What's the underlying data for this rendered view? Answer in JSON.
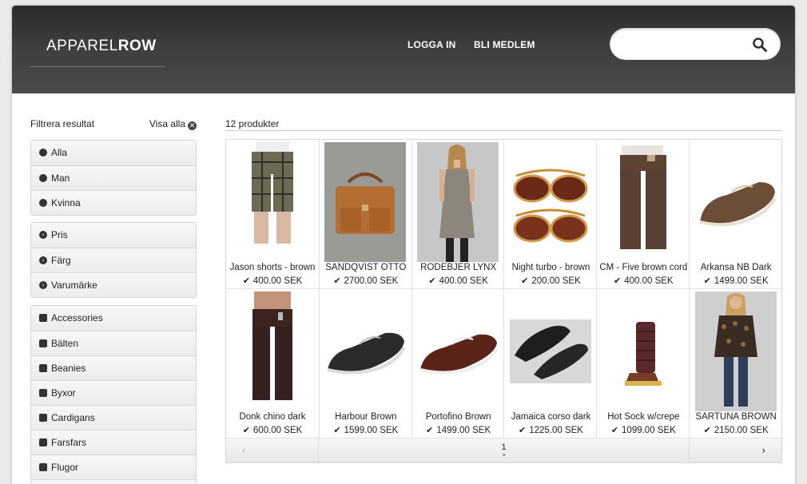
{
  "header": {
    "logo_light": "APPAREL",
    "logo_bold": "ROW",
    "nav": {
      "login": "LOGGA IN",
      "signup": "BLI MEDLEM"
    },
    "search": {
      "value": "",
      "placeholder": ""
    }
  },
  "sidebar": {
    "title": "Filtrera resultat",
    "show_all": "Visa alla",
    "gender": [
      "Alla",
      "Man",
      "Kvinna"
    ],
    "filters": [
      "Pris",
      "Färg",
      "Varumärke"
    ],
    "categories": [
      "Accessories",
      "Bälten",
      "Beanies",
      "Byxor",
      "Cardigans",
      "Farsfars",
      "Flugor"
    ]
  },
  "results": {
    "count": "12 produkter",
    "products": [
      {
        "name": "Jason shorts - brown",
        "price": "400.00 SEK",
        "img": "plaid-shorts"
      },
      {
        "name": "SANDQVIST OTTO",
        "price": "2700.00 SEK",
        "img": "leather-bag"
      },
      {
        "name": "RODEBJER LYNX",
        "price": "400.00 SEK",
        "img": "dress"
      },
      {
        "name": "Night turbo - brown",
        "price": "200.00 SEK",
        "img": "sunglasses"
      },
      {
        "name": "CM - Five brown cord",
        "price": "400.00 SEK",
        "img": "cord-pants"
      },
      {
        "name": "Arkansa NB Dark",
        "price": "1499.00 SEK",
        "img": "boat-shoe"
      },
      {
        "name": "Donk chino dark",
        "price": "600.00 SEK",
        "img": "chino"
      },
      {
        "name": "Harbour Brown",
        "price": "1599.00 SEK",
        "img": "shoe-dark"
      },
      {
        "name": "Portofino Brown",
        "price": "1499.00 SEK",
        "img": "shoe-red"
      },
      {
        "name": "Jamaica corso dark",
        "price": "1225.00 SEK",
        "img": "shoe-black"
      },
      {
        "name": "Hot Sock w/crepe",
        "price": "1099.00 SEK",
        "img": "boot"
      },
      {
        "name": "SARTUNA BROWN",
        "price": "2150.00 SEK",
        "img": "jacket"
      }
    ],
    "pagination": {
      "current": "1"
    }
  },
  "colors": {
    "header_dark": "#2b2b2b",
    "accent": "#222222"
  }
}
